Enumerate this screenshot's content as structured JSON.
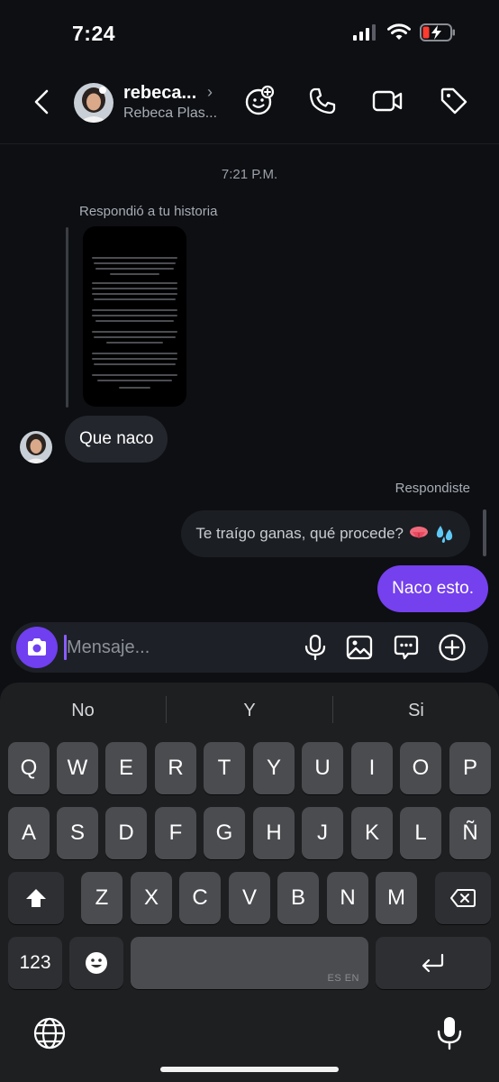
{
  "status_bar": {
    "time": "7:24"
  },
  "header": {
    "username": "rebeca...",
    "full_name": "Rebeca Plas...",
    "chevron": "›"
  },
  "chat": {
    "timestamp": "7:21 P.M.",
    "story_caption": "Respondió a tu historia",
    "received_message": "Que naco",
    "reply_label": "Respondiste",
    "quoted_message": "Te traígo ganas, qué procede?",
    "quoted_emojis": [
      "tongue-emoji",
      "sweat-droplets-emoji"
    ],
    "sent_message": "Naco esto."
  },
  "composer": {
    "placeholder": "Mensaje..."
  },
  "keyboard": {
    "suggestions": [
      "No",
      "Y",
      "Si"
    ],
    "row1": [
      "Q",
      "W",
      "E",
      "R",
      "T",
      "Y",
      "U",
      "I",
      "O",
      "P"
    ],
    "row2": [
      "A",
      "S",
      "D",
      "F",
      "G",
      "H",
      "J",
      "K",
      "L",
      "Ñ"
    ],
    "row3": [
      "Z",
      "X",
      "C",
      "V",
      "B",
      "N",
      "M"
    ],
    "numbers_key": "123",
    "space_lang": "ES EN"
  },
  "colors": {
    "background": "#0d0f13",
    "sent_bubble": "#7540ee",
    "received_bubble": "#23262c",
    "camera_button": "#6f3ff0"
  }
}
